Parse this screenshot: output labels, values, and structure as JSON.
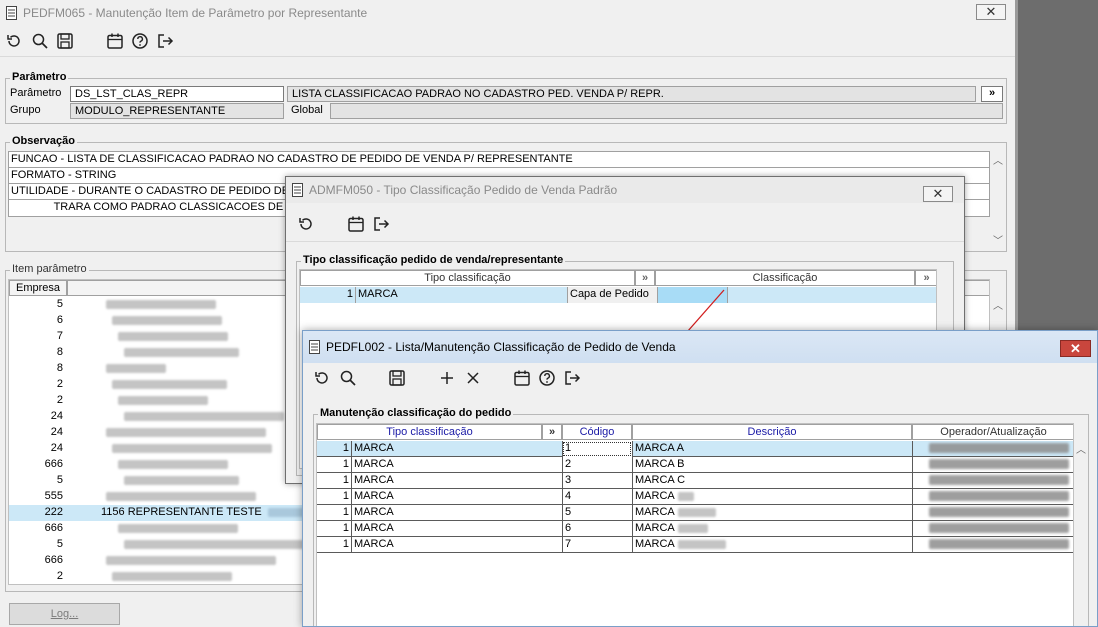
{
  "main": {
    "title": "PEDFM065 - Manutenção Item de Parâmetro por Representante",
    "close_glyph": "✕",
    "parametro": {
      "group_title": "Parâmetro",
      "label_parametro": "Parâmetro",
      "label_grupo": "Grupo",
      "parametro_value": "DS_LST_CLAS_REPR",
      "parametro_desc": "LISTA CLASSIFICACAO PADRAO NO CADASTRO PED. VENDA P/ REPR.",
      "grupo_value": "MODULO_REPRESENTANTE",
      "global_label": "Global",
      "expand_glyph": "»"
    },
    "observacao": {
      "group_title": "Observação",
      "lines": [
        "FUNCAO - LISTA DE CLASSIFICACAO PADRAO NO CADASTRO DE PEDIDO DE VENDA P/ REPRESENTANTE",
        "FORMATO - STRING",
        "UTILIDADE - DURANTE O CADASTRO DE PEDIDO DE VENDA",
        "              TRARA COMO PADRAO CLASSICACOES DE"
      ]
    },
    "item_parametro": {
      "group_title": "Item parâmetro",
      "col_empresa": "Empresa",
      "rows": [
        {
          "empresa": "5",
          "text": ""
        },
        {
          "empresa": "6",
          "text": ""
        },
        {
          "empresa": "7",
          "text": ""
        },
        {
          "empresa": "8",
          "text": ""
        },
        {
          "empresa": "8",
          "text": ""
        },
        {
          "empresa": "2",
          "text": ""
        },
        {
          "empresa": "2",
          "text": ""
        },
        {
          "empresa": "24",
          "text": ""
        },
        {
          "empresa": "24",
          "text": ""
        },
        {
          "empresa": "24",
          "text": ""
        },
        {
          "empresa": "666",
          "text": ""
        },
        {
          "empresa": "5",
          "text": ""
        },
        {
          "empresa": "555",
          "text": ""
        },
        {
          "empresa": "222",
          "text": "1156 REPRESENTANTE TESTE"
        },
        {
          "empresa": "666",
          "text": ""
        },
        {
          "empresa": "5",
          "text": ""
        },
        {
          "empresa": "666",
          "text": ""
        },
        {
          "empresa": "2",
          "text": ""
        }
      ]
    },
    "log_button": "Log..."
  },
  "adm": {
    "title": "ADMFM050 - Tipo Classificação Pedido de Venda Padrão",
    "close_glyph": "✕",
    "group_title": "Tipo classificação pedido de venda/representante",
    "col_tipo": "Tipo classificação",
    "col_classificacao": "Classificação",
    "expand_glyph": "»",
    "row": {
      "num": "1",
      "tipo": "MARCA",
      "classif": "Capa de Pedido"
    }
  },
  "pedfl": {
    "title": "PEDFL002 - Lista/Manutenção Classificação de Pedido de Venda",
    "close_glyph": "✕",
    "group_title": "Manutenção classificação do pedido",
    "col_tipo": "Tipo classificação",
    "col_codigo": "Código",
    "col_descricao": "Descrição",
    "col_operador": "Operador/Atualização",
    "expand_glyph": "»",
    "rows": [
      {
        "num": "1",
        "tipo": "MARCA",
        "codigo": "1",
        "descricao": "MARCA A"
      },
      {
        "num": "1",
        "tipo": "MARCA",
        "codigo": "2",
        "descricao": "MARCA B"
      },
      {
        "num": "1",
        "tipo": "MARCA",
        "codigo": "3",
        "descricao": "MARCA C"
      },
      {
        "num": "1",
        "tipo": "MARCA",
        "codigo": "4",
        "descricao": "MARCA"
      },
      {
        "num": "1",
        "tipo": "MARCA",
        "codigo": "5",
        "descricao": "MARCA"
      },
      {
        "num": "1",
        "tipo": "MARCA",
        "codigo": "6",
        "descricao": "MARCA"
      },
      {
        "num": "1",
        "tipo": "MARCA",
        "codigo": "7",
        "descricao": "MARCA"
      }
    ]
  },
  "colors": {
    "selection": "#cce8f7",
    "header_text_blue": "#1a1aa6",
    "close_red": "#c42b1c",
    "arrow_red": "#d21d1d"
  }
}
